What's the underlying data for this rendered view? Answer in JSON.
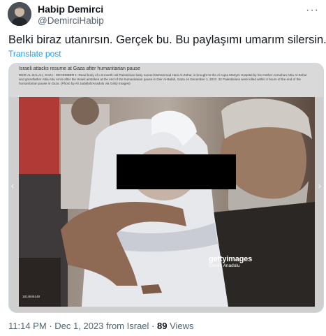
{
  "author": {
    "display_name": "Habip Demirci",
    "handle": "@DemirciHabip",
    "avatar_icon": "user-avatar"
  },
  "more_icon": "more-options-icon",
  "tweet": {
    "text": "Belki biraz utanırsın. Gerçek bu. Bu paylaşımı umarım silersin.",
    "translate_label": "Translate post"
  },
  "media": {
    "caption_title": "Israeli attacks resume at Gaza after humanitarian pause",
    "caption_body": "DEIR AL-BALAH, GAZA - DECEMBER 1: Dead body of a 5-month-old Palestinian baby named Muhammad Hani Al-Zahar, is brought to the Al-Aqsa Martyrs Hospital by his mother Asmahan Attia Al-Zahar and grandfather Attia Abu Amra after the Israeli airstrikes at the end of the humanitarian pause in Deir Al-Balah, Gaza on December 1, 2023. 32 Palestinians were killed within 3 hours of the end of the humanitarian pause in Gaza. (Photo by Ali Jadallah/Anadolu via Getty Images)",
    "watermark_logo": "gettyimages",
    "watermark_credit": "Credit: Anadolu",
    "photo_id": "1814846148",
    "nav_left": "‹",
    "nav_right": "›"
  },
  "meta": {
    "time": "11:14 PM",
    "date": "Dec 1, 2023",
    "location": "from Israel",
    "separator": "·",
    "views_count": "89",
    "views_label": "Views"
  },
  "colors": {
    "text_primary": "#0f1419",
    "text_secondary": "#536471",
    "link": "#1d9bf0",
    "border": "#cfd9de"
  }
}
